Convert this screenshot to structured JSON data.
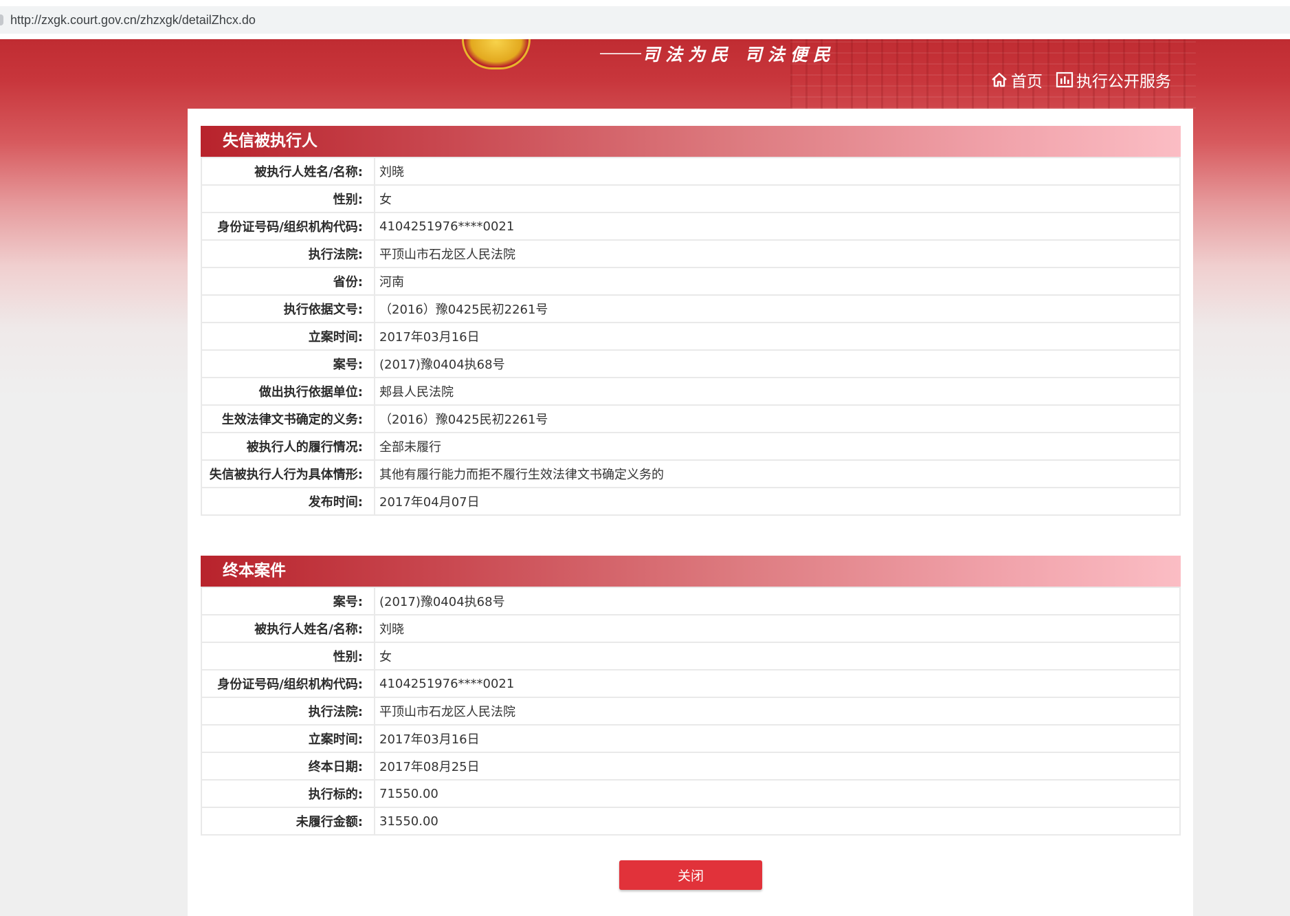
{
  "browser": {
    "url": "http://zxgk.court.gov.cn/zhzxgk/detailZhcx.do"
  },
  "header": {
    "slogan": "司法为民  司法便民",
    "nav_home": "首页",
    "nav_service": "执行公开服务",
    "colors": {
      "primary": "#c02c32",
      "accent": "#e1323a"
    }
  },
  "dishonest": {
    "title": "失信被执行人",
    "rows": [
      {
        "label": "被执行人姓名/名称:",
        "value": "刘晓"
      },
      {
        "label": "性别:",
        "value": "女"
      },
      {
        "label": "身份证号码/组织机构代码:",
        "value": "4104251976****0021"
      },
      {
        "label": "执行法院:",
        "value": "平顶山市石龙区人民法院"
      },
      {
        "label": "省份:",
        "value": "河南"
      },
      {
        "label": "执行依据文号:",
        "value": "（2016）豫0425民初2261号"
      },
      {
        "label": "立案时间:",
        "value": "2017年03月16日"
      },
      {
        "label": "案号:",
        "value": "(2017)豫0404执68号"
      },
      {
        "label": "做出执行依据单位:",
        "value": "郏县人民法院"
      },
      {
        "label": "生效法律文书确定的义务:",
        "value": "（2016）豫0425民初2261号"
      },
      {
        "label": "被执行人的履行情况:",
        "value": "全部未履行"
      },
      {
        "label": "失信被执行人行为具体情形:",
        "value": "其他有履行能力而拒不履行生效法律文书确定义务的"
      },
      {
        "label": "发布时间:",
        "value": "2017年04月07日"
      }
    ]
  },
  "terminated": {
    "title": "终本案件",
    "rows": [
      {
        "label": "案号:",
        "value": "(2017)豫0404执68号"
      },
      {
        "label": "被执行人姓名/名称:",
        "value": "刘晓"
      },
      {
        "label": "性别:",
        "value": "女"
      },
      {
        "label": "身份证号码/组织机构代码:",
        "value": "4104251976****0021"
      },
      {
        "label": "执行法院:",
        "value": "平顶山市石龙区人民法院"
      },
      {
        "label": "立案时间:",
        "value": "2017年03月16日"
      },
      {
        "label": "终本日期:",
        "value": "2017年08月25日"
      },
      {
        "label": "执行标的:",
        "value": "71550.00"
      },
      {
        "label": "未履行金额:",
        "value": "31550.00"
      }
    ]
  },
  "close_button": "关闭"
}
